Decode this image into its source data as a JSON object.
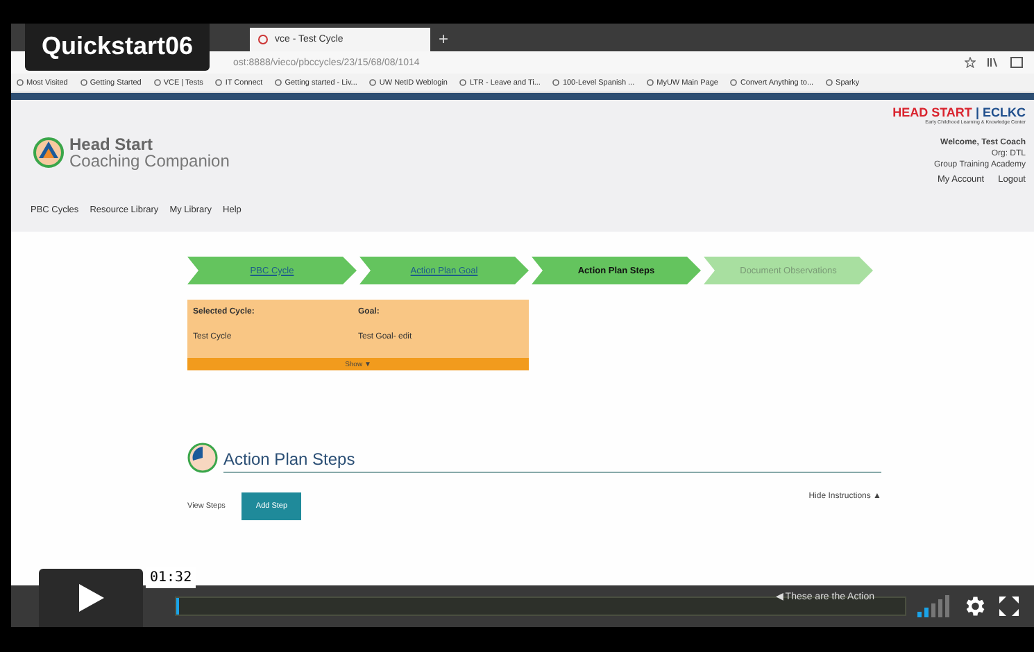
{
  "video": {
    "title": "Quickstart06",
    "hover_time": "01:32",
    "progress": {
      "level": 0.003
    }
  },
  "browser": {
    "tab": "vce - Test Cycle",
    "new_tab": "+",
    "url": "ost:8888/vieco/pbccycles/23/15/68/08/1014",
    "bookmarks": [
      "Most Visited",
      "Getting Started",
      "VCE | Tests",
      "IT Connect",
      "Getting started - Liv...",
      "UW NetID Weblogin",
      "LTR - Leave and Ti...",
      "100-Level Spanish ...",
      "MyUW Main Page",
      "Convert Anything to...",
      "Sparky"
    ]
  },
  "header": {
    "app_name": "Head Start",
    "app_subtitle": "Coaching Companion",
    "partner_name": "HEAD START",
    "partner_separator": "|",
    "partner_suffix": "ECLKC",
    "partner_tagline": "Early Childhood Learning & Knowledge Center",
    "welcome": "Welcome, Test Coach",
    "org": "Org: DTL",
    "group": "Group Training Academy",
    "links": [
      "My Account",
      "Logout"
    ]
  },
  "nav": [
    "PBC Cycles",
    "Resource Library",
    "My Library",
    "Help"
  ],
  "steps": [
    {
      "label": "PBC Cycle",
      "selected": false,
      "disabled": false
    },
    {
      "label": "Action Plan Goal",
      "selected": false,
      "disabled": false
    },
    {
      "label": "Action Plan Steps",
      "selected": true,
      "disabled": false
    },
    {
      "label": "Document Observations",
      "selected": false,
      "disabled": true
    }
  ],
  "summary": {
    "cycle_label": "Selected Cycle:",
    "cycle_value": "Test Cycle",
    "goal_label": "Goal:",
    "goal_value": "Test Goal- edit",
    "toggle": "Show ▼"
  },
  "section": {
    "title": "Action Plan Steps",
    "view_steps": "View Steps",
    "add_step": "Add Step",
    "hide_instructions": "Hide Instructions ▲",
    "instruction": "◀ These are the Action"
  }
}
